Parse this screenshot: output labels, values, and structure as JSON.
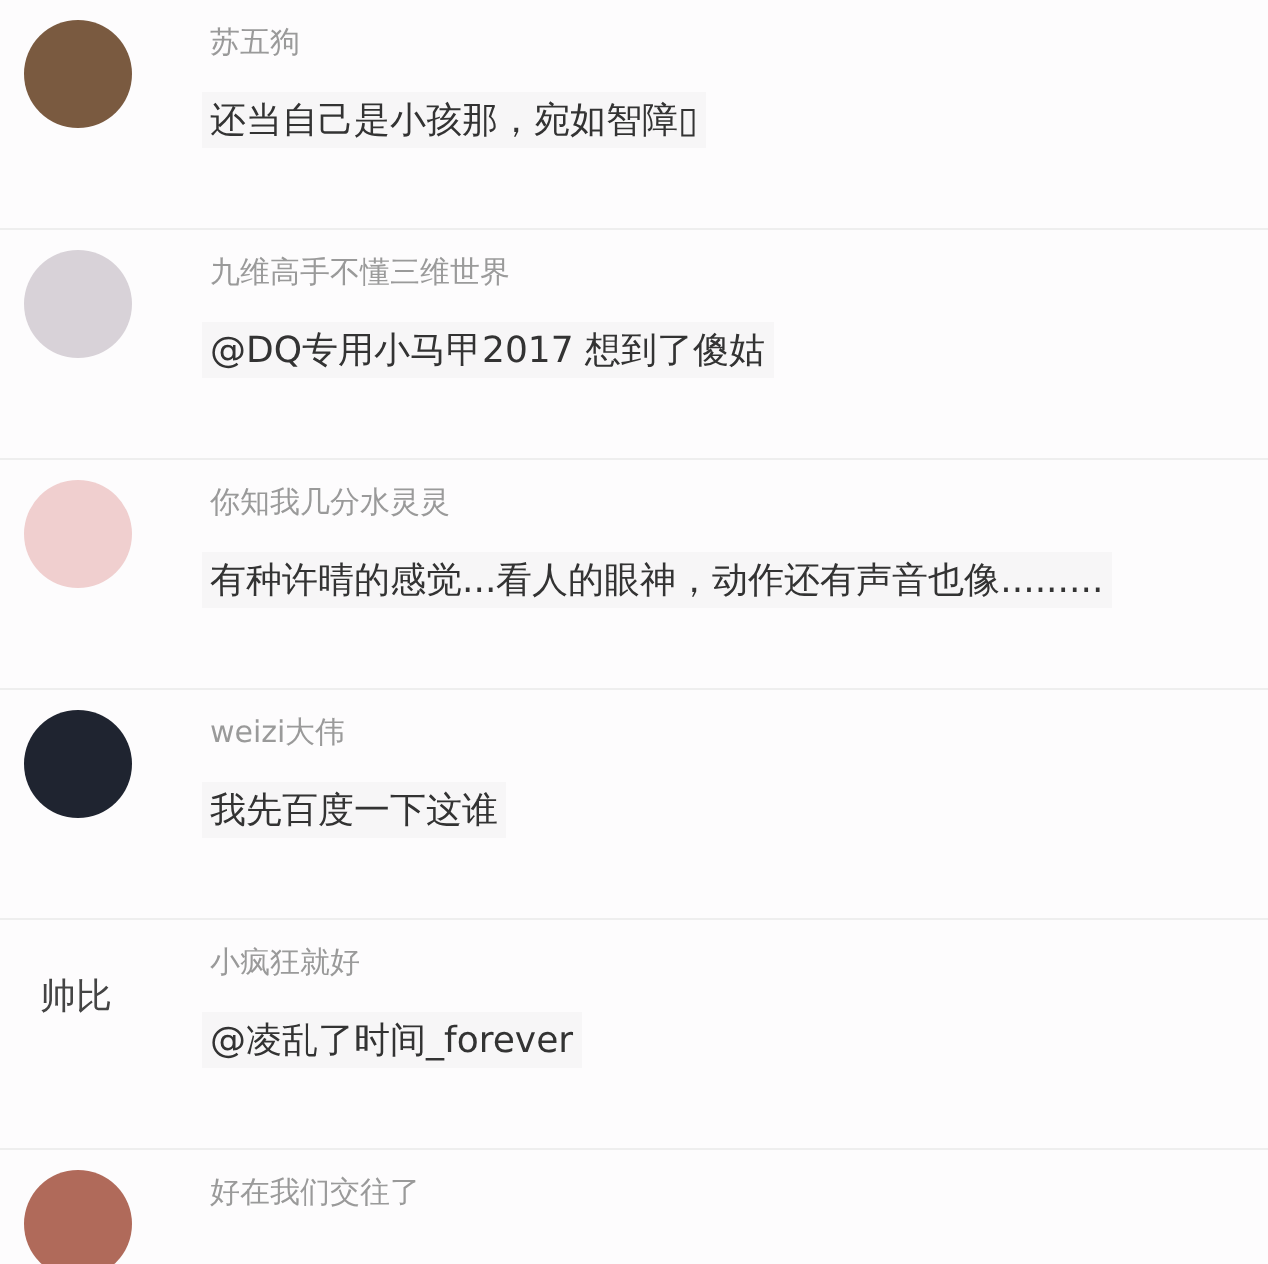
{
  "comments": [
    {
      "name": "苏五狗",
      "text": "还当自己是小孩那，宛如智障▯"
    },
    {
      "name": "九维高手不懂三维世界",
      "text": "@DQ专用小马甲2017 想到了傻姑"
    },
    {
      "name": "你知我几分水灵灵",
      "text": "有种许晴的感觉...看人的眼神，动作还有声音也像........."
    },
    {
      "name": "weizi大伟",
      "text": "我先百度一下这谁"
    },
    {
      "avatar": {
        "kind": "text",
        "label": "帅比"
      },
      "name": "小疯狂就好",
      "text": "@凌乱了时间_forever"
    },
    {
      "name": "好在我们交往了"
    }
  ]
}
